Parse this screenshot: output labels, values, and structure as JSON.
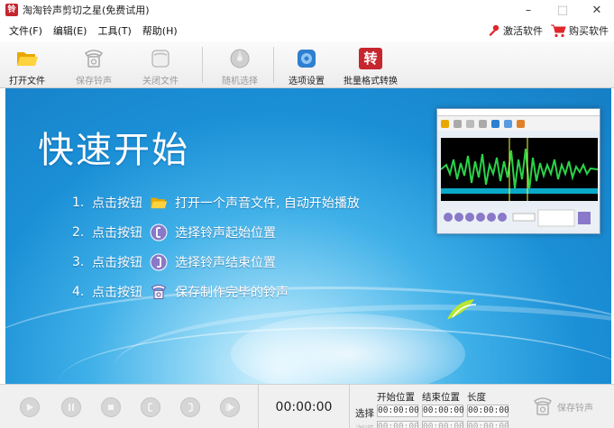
{
  "window": {
    "title": "淘淘铃声剪切之星(免费试用)",
    "app_icon_text": "铃",
    "minimize": "–",
    "maximize": "□",
    "close": "✕"
  },
  "menu": {
    "items": [
      "文件(F)",
      "编辑(E)",
      "工具(T)",
      "帮助(H)"
    ],
    "activate": "激活软件",
    "buy": "购买软件"
  },
  "toolbar": {
    "open_file": "打开文件",
    "save_ringtone": "保存铃声",
    "close_file": "关闭文件",
    "random_select": "随机选择",
    "options": "选项设置",
    "batch_convert": "批量格式转换",
    "batch_icon_text": "转"
  },
  "banner": {
    "title": "快速开始",
    "steps": [
      {
        "num": "1.",
        "prefix": "点击按钮",
        "text": "打开一个声音文件, 自动开始播放"
      },
      {
        "num": "2.",
        "prefix": "点击按钮",
        "text": "选择铃声起始位置"
      },
      {
        "num": "3.",
        "prefix": "点击按钮",
        "text": "选择铃声结束位置"
      },
      {
        "num": "4.",
        "prefix": "点击按钮",
        "text": "保存制作完毕的铃声"
      }
    ]
  },
  "bottom": {
    "time": "00:00:00",
    "col_start": "开始位置",
    "col_end": "结束位置",
    "col_length": "长度",
    "row_select": "选择",
    "row_view": "浏览",
    "select_start": "00:00:00",
    "select_end": "00:00:00",
    "select_length": "00:00:00",
    "view_start": "00:00:00",
    "view_end": "00:00:00",
    "view_length": "00:00:00",
    "save_ringtone": "保存铃声"
  },
  "colors": {
    "banner_blue": "#1b8fd6",
    "accent_red": "#c6262e",
    "folder_yellow": "#f2b300",
    "cart_red": "#e0262b",
    "disabled_text": "#9a9a9a"
  }
}
